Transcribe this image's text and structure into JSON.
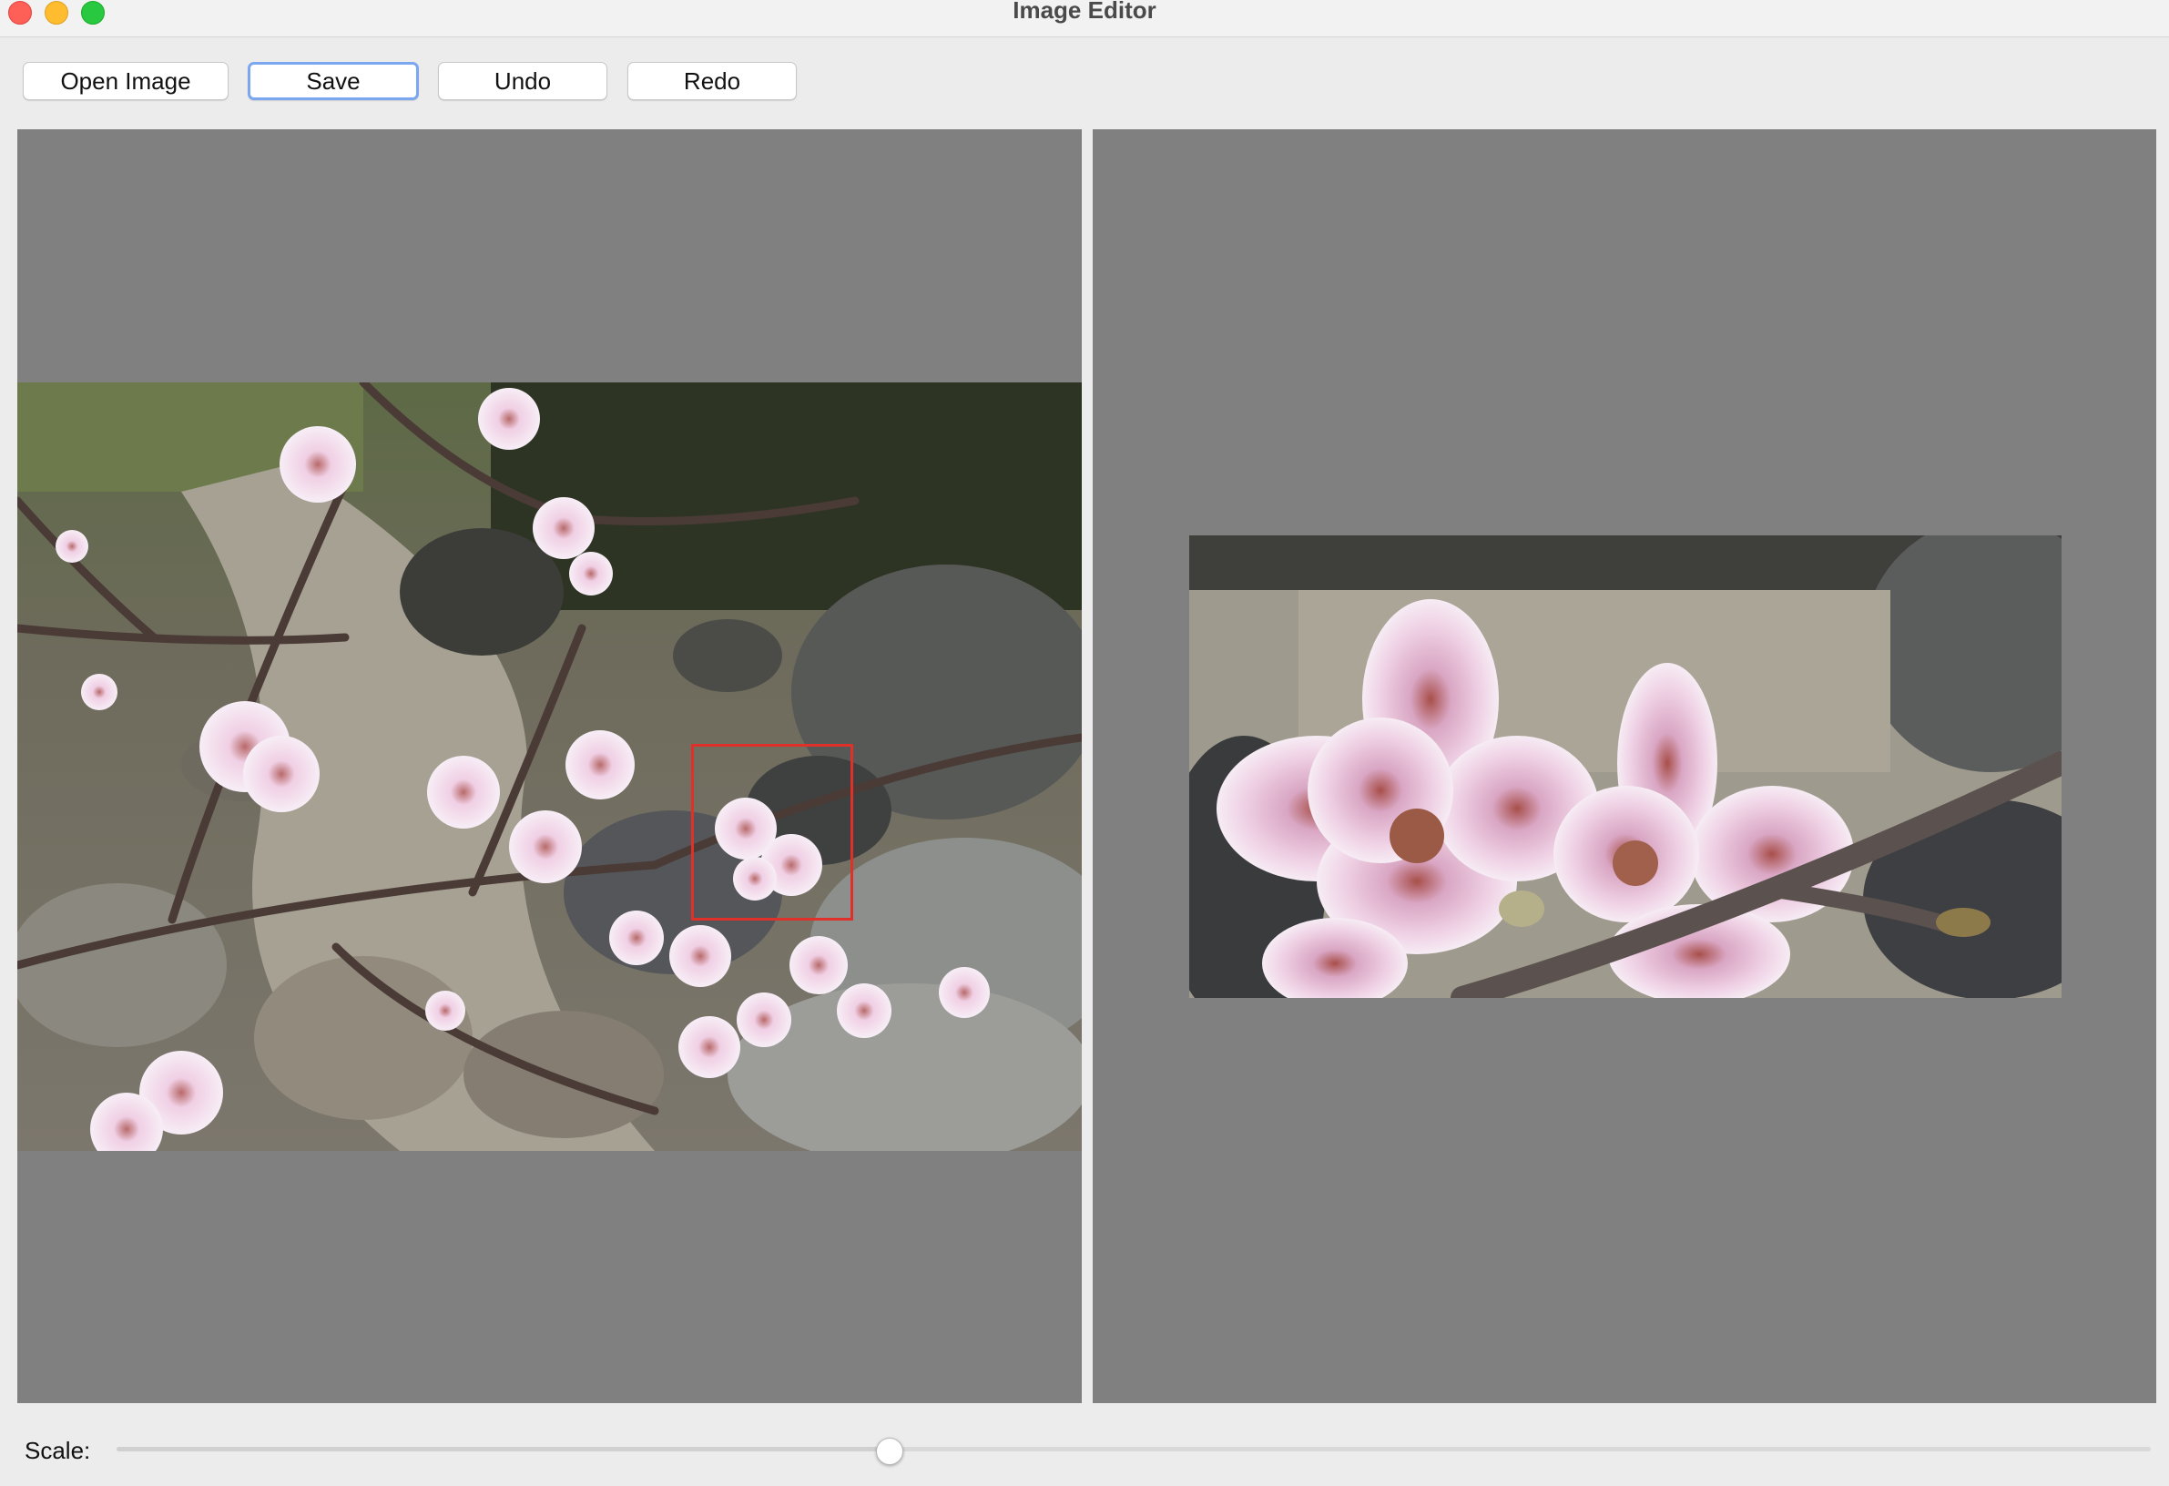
{
  "window": {
    "title": "Image Editor"
  },
  "toolbar": {
    "open_label": "Open Image",
    "save_label": "Save",
    "undo_label": "Undo",
    "redo_label": "Redo"
  },
  "canvas": {
    "original_image": "cherry-blossom-stream-photo",
    "preview_image": "cropped-blossom-closeup"
  },
  "scale": {
    "label": "Scale:",
    "value_fraction": 0.38
  },
  "colors": {
    "accent_focus": "#7aa7f0",
    "selection": "#e0302a",
    "canvas_bg": "#808080"
  }
}
